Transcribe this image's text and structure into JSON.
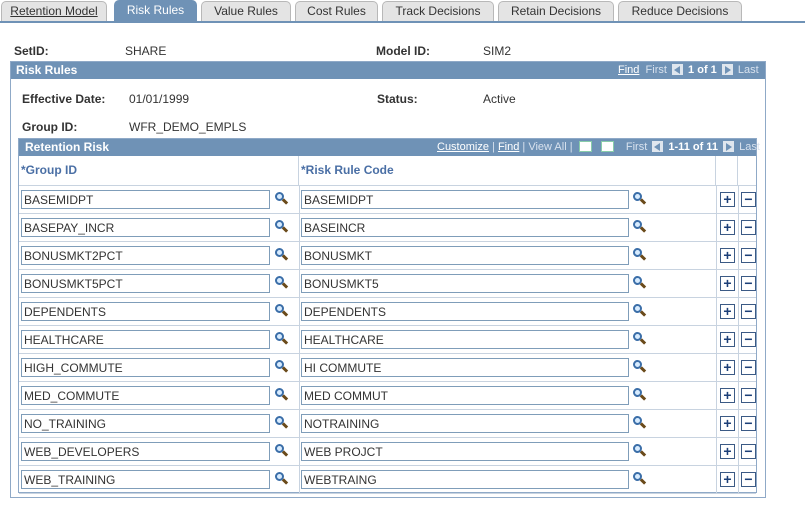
{
  "tabs": [
    {
      "label": "Retention Model",
      "active": false
    },
    {
      "label": "Risk Rules",
      "active": true
    },
    {
      "label": "Value Rules",
      "active": false
    },
    {
      "label": "Cost Rules",
      "active": false
    },
    {
      "label": "Track Decisions",
      "active": false
    },
    {
      "label": "Retain Decisions",
      "active": false
    },
    {
      "label": "Reduce Decisions",
      "active": false
    }
  ],
  "header": {
    "setid_label": "SetID:",
    "setid_value": "SHARE",
    "modelid_label": "Model ID:",
    "modelid_value": "SIM2"
  },
  "risk_rules": {
    "title": "Risk Rules",
    "nav": {
      "find": "Find",
      "first": "First",
      "count": "1 of 1",
      "last": "Last"
    },
    "effective_date_label": "Effective Date:",
    "effective_date_value": "01/01/1999",
    "status_label": "Status:",
    "status_value": "Active",
    "group_id_label": "Group ID:",
    "group_id_value": "WFR_DEMO_EMPLS"
  },
  "retention_risk": {
    "title": "Retention Risk",
    "nav": {
      "customize": "Customize",
      "find": "Find",
      "view_all": "View All",
      "first": "First",
      "count": "1-11 of 11",
      "last": "Last"
    },
    "columns": {
      "group_id": "*Group ID",
      "risk_rule_code": "*Risk Rule Code"
    },
    "rows": [
      {
        "group_id": "BASEMIDPT",
        "risk_rule_code": "BASEMIDPT"
      },
      {
        "group_id": "BASEPAY_INCR",
        "risk_rule_code": "BASEINCR"
      },
      {
        "group_id": "BONUSMKT2PCT",
        "risk_rule_code": "BONUSMKT"
      },
      {
        "group_id": "BONUSMKT5PCT",
        "risk_rule_code": "BONUSMKT5"
      },
      {
        "group_id": "DEPENDENTS",
        "risk_rule_code": "DEPENDENTS"
      },
      {
        "group_id": "HEALTHCARE",
        "risk_rule_code": "HEALTHCARE"
      },
      {
        "group_id": "HIGH_COMMUTE",
        "risk_rule_code": "HI COMMUTE"
      },
      {
        "group_id": "MED_COMMUTE",
        "risk_rule_code": "MED COMMUT"
      },
      {
        "group_id": "NO_TRAINING",
        "risk_rule_code": "NOTRAINING"
      },
      {
        "group_id": "WEB_DEVELOPERS",
        "risk_rule_code": "WEB PROJCT"
      },
      {
        "group_id": "WEB_TRAINING",
        "risk_rule_code": "WEBTRAING"
      }
    ],
    "add_symbol": "+",
    "remove_symbol": "−",
    "icons": {
      "lookup": "lookup-icon",
      "grid_view": "grid-view-icon",
      "download": "download-icon"
    }
  }
}
